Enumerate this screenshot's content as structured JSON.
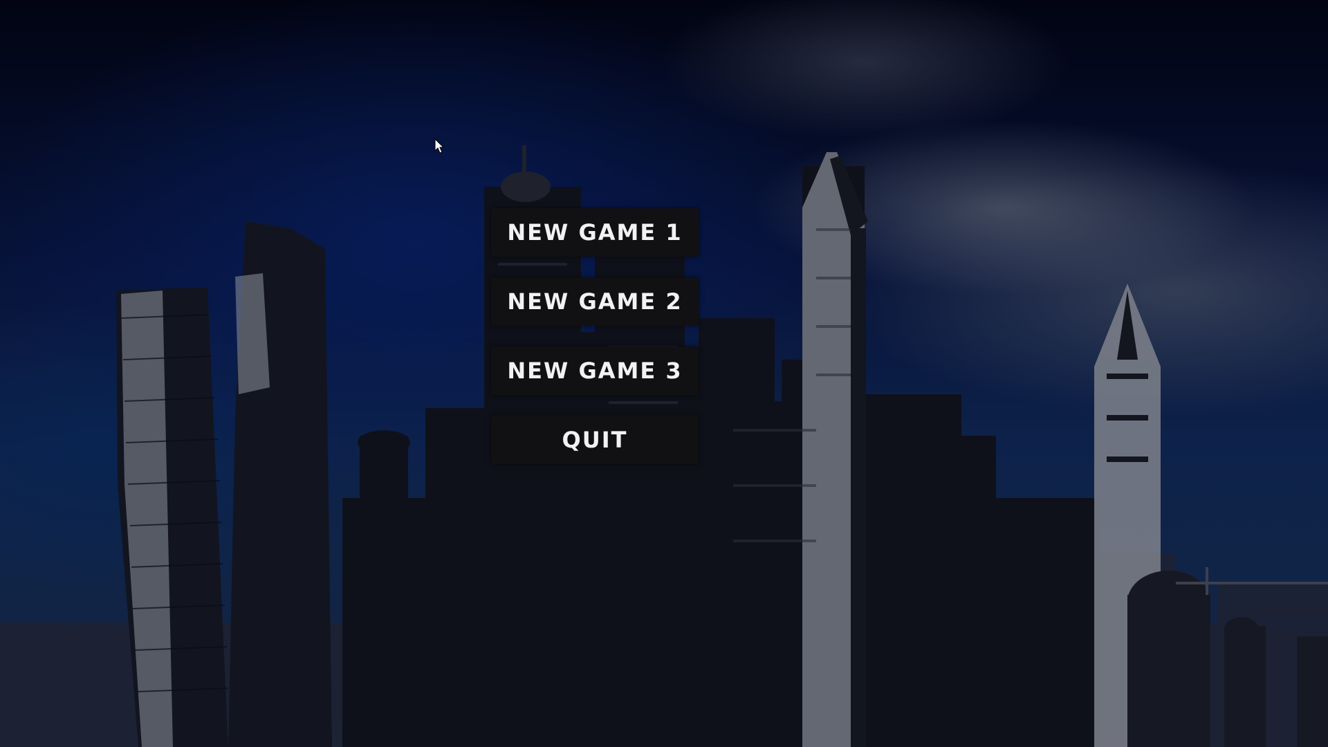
{
  "main_menu": {
    "buttons": [
      {
        "label": "NEW GAME 1"
      },
      {
        "label": "NEW GAME 2"
      },
      {
        "label": "NEW GAME 3"
      },
      {
        "label": "QUIT"
      }
    ]
  },
  "background": {
    "scene": "city-skyline",
    "sky_color": "#0a1a4a",
    "button_color": "#111114",
    "text_color": "#f2f2f2"
  },
  "cursor": {
    "icon": "arrow-cursor-icon"
  }
}
